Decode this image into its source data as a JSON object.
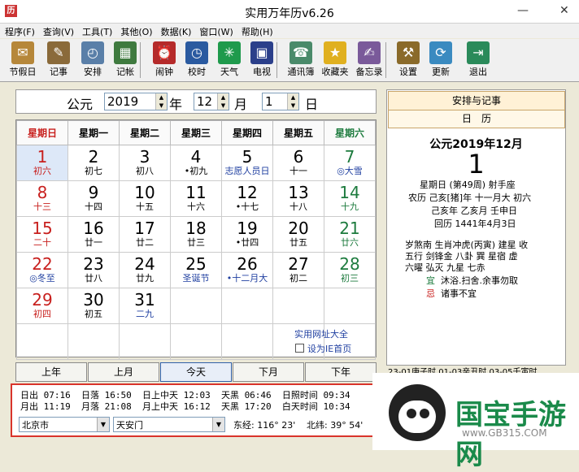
{
  "window": {
    "title": "实用万年历v6.26",
    "minimize": "—",
    "close": "✕"
  },
  "menu": [
    "程序(F)",
    "查询(V)",
    "工具(T)",
    "其他(O)",
    "数据(K)",
    "窗口(W)",
    "帮助(H)"
  ],
  "toolbar": [
    {
      "label": "节假日",
      "icon": "holiday-icon",
      "color": "#b6873a"
    },
    {
      "label": "记事",
      "icon": "notes-icon",
      "color": "#8a6a3a"
    },
    {
      "label": "安排",
      "icon": "schedule-icon",
      "color": "#5a7fa8"
    },
    {
      "label": "记帐",
      "icon": "ledger-icon",
      "color": "#3f7a3f"
    },
    {
      "label": "闹钟",
      "icon": "alarm-clock-icon",
      "color": "#b52a2a"
    },
    {
      "label": "校时",
      "icon": "time-sync-icon",
      "color": "#2a5aa0"
    },
    {
      "label": "天气",
      "icon": "weather-icon",
      "color": "#1f9a4c"
    },
    {
      "label": "电视",
      "icon": "tv-icon",
      "color": "#2b3f8a"
    },
    {
      "label": "通讯簿",
      "icon": "address-book-icon",
      "color": "#4a8a6a"
    },
    {
      "label": "收藏夹",
      "icon": "favorites-star-icon",
      "color": "#e0b020"
    },
    {
      "label": "备忘录",
      "icon": "memo-icon",
      "color": "#7a5a9a"
    },
    {
      "label": "设置",
      "icon": "settings-tools-icon",
      "color": "#8a6a2a"
    },
    {
      "label": "更新",
      "icon": "update-icon",
      "color": "#3a8ac0"
    },
    {
      "label": "退出",
      "icon": "exit-door-icon",
      "color": "#2a8a5a"
    }
  ],
  "datebar": {
    "era": "公元",
    "year": "2019",
    "year_unit": "年",
    "month": "12",
    "month_unit": "月",
    "day": "1",
    "day_unit": "日"
  },
  "weekdays": [
    "星期日",
    "星期一",
    "星期二",
    "星期三",
    "星期四",
    "星期五",
    "星期六"
  ],
  "weeks": [
    [
      {
        "d": "1",
        "s": "初六",
        "dc": "red",
        "sc": "red",
        "today": true
      },
      {
        "d": "2",
        "s": "初七"
      },
      {
        "d": "3",
        "s": "初八"
      },
      {
        "d": "4",
        "s": "•初九"
      },
      {
        "d": "5",
        "s": "志愿人员日",
        "sc": "blue"
      },
      {
        "d": "6",
        "s": "十一"
      },
      {
        "d": "7",
        "s": "◎大雪",
        "dc": "green",
        "sc": "blue"
      }
    ],
    [
      {
        "d": "8",
        "s": "十三",
        "dc": "red",
        "sc": "red"
      },
      {
        "d": "9",
        "s": "十四"
      },
      {
        "d": "10",
        "s": "十五"
      },
      {
        "d": "11",
        "s": "十六"
      },
      {
        "d": "12",
        "s": "•十七"
      },
      {
        "d": "13",
        "s": "十八"
      },
      {
        "d": "14",
        "s": "十九",
        "dc": "green",
        "sc": "green"
      }
    ],
    [
      {
        "d": "15",
        "s": "二十",
        "dc": "red",
        "sc": "red"
      },
      {
        "d": "16",
        "s": "廿一"
      },
      {
        "d": "17",
        "s": "廿二"
      },
      {
        "d": "18",
        "s": "廿三"
      },
      {
        "d": "19",
        "s": "•廿四"
      },
      {
        "d": "20",
        "s": "廿五"
      },
      {
        "d": "21",
        "s": "廿六",
        "dc": "green",
        "sc": "green"
      }
    ],
    [
      {
        "d": "22",
        "s": "◎冬至",
        "dc": "red",
        "sc": "blue"
      },
      {
        "d": "23",
        "s": "廿八"
      },
      {
        "d": "24",
        "s": "廿九"
      },
      {
        "d": "25",
        "s": "圣诞节",
        "sc": "blue"
      },
      {
        "d": "26",
        "s": "•十二月大",
        "sc": "blue"
      },
      {
        "d": "27",
        "s": "初二"
      },
      {
        "d": "28",
        "s": "初三",
        "dc": "green",
        "sc": "green"
      }
    ],
    [
      {
        "d": "29",
        "s": "初四",
        "dc": "red",
        "sc": "red"
      },
      {
        "d": "30",
        "s": "初五"
      },
      {
        "d": "31",
        "s": "二九",
        "sc": "blue"
      },
      {
        "d": "",
        "s": ""
      },
      {
        "d": "",
        "s": ""
      },
      {
        "d": "",
        "s": ""
      },
      {
        "d": "",
        "s": ""
      }
    ],
    [
      {
        "d": "",
        "s": ""
      },
      {
        "d": "",
        "s": ""
      },
      {
        "d": "",
        "s": ""
      },
      {
        "d": "",
        "s": ""
      },
      {
        "d": "",
        "s": ""
      },
      {
        "d": "",
        "s": ""
      },
      {
        "d": "",
        "s": ""
      }
    ]
  ],
  "calendar_links": {
    "site": "实用网址大全",
    "homepage": "设为IE首页"
  },
  "nav": {
    "prev_year": "上年",
    "prev_month": "上月",
    "today": "今天",
    "next_month": "下月",
    "next_year": "下年"
  },
  "sun": {
    "row1": "日出 07:16  日落 16:50  日上中天 12:03  天黑 06:46  日照时间 09:34",
    "row2": "月出 11:19  月落 21:08  月上中天 16:12  天黑 17:20  白天时间 10:34",
    "city": "北京市",
    "place": "天安门",
    "lng": "东经: 116° 23'",
    "lat": "北纬: 39° 54'"
  },
  "right": {
    "header": "安排与记事",
    "subheader": "日　历",
    "ym": "公元2019年12月",
    "day": "1",
    "l1": "星期日  (第49周)  射手座",
    "l2": "农历  己亥[猪]年  十一月大  初六",
    "l3": "己亥年  乙亥月  壬申日",
    "l4": "回历  1441年4月3日",
    "l5": "岁煞南  生肖冲虎(丙寅)   建星  收",
    "l6": "五行  剑锋金   八卦  巽   星宿  虚",
    "l7": "六曜  弘灭   九星  七赤",
    "yi_label": "宜",
    "yi": "沐浴.扫舍.余事勿取",
    "ji_label": "忌",
    "ji": "诸事不宜",
    "bottom": "23-01庚子时 01-03辛丑时 03-05壬寅时"
  },
  "watermark": {
    "name": "国宝手游网",
    "url": "www.GB315.COM"
  }
}
